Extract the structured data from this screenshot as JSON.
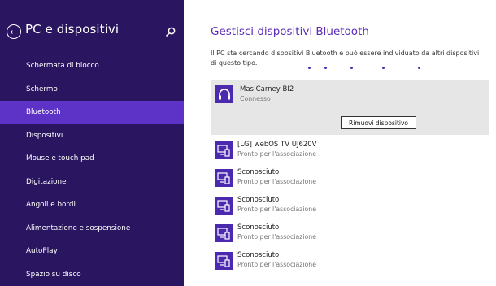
{
  "sidebar": {
    "title": "PC e dispositivi",
    "items": [
      {
        "label": "Schermata di blocco"
      },
      {
        "label": "Schermo"
      },
      {
        "label": "Bluetooth"
      },
      {
        "label": "Dispositivi"
      },
      {
        "label": "Mouse e touch pad"
      },
      {
        "label": "Digitazione"
      },
      {
        "label": "Angoli e bordi"
      },
      {
        "label": "Alimentazione e sospensione"
      },
      {
        "label": "AutoPlay"
      },
      {
        "label": "Spazio su disco"
      }
    ],
    "active_index": 2
  },
  "main": {
    "title": "Gestisci dispositivi Bluetooth",
    "description": "Il PC sta cercando dispositivi Bluetooth e può essere individuato da altri dispositivi di questo tipo.",
    "selected_device": {
      "name": "Mas Carney BI2",
      "status": "Connesso",
      "icon": "headphones-icon",
      "action_label": "Rimuovi dispositivo"
    },
    "devices": [
      {
        "name": "[LG] webOS TV UJ620V",
        "status": "Pronto per l'associazione",
        "icon": "device-icon"
      },
      {
        "name": "Sconosciuto",
        "status": "Pronto per l'associazione",
        "icon": "device-icon"
      },
      {
        "name": "Sconosciuto",
        "status": "Pronto per l'associazione",
        "icon": "device-icon"
      },
      {
        "name": "Sconosciuto",
        "status": "Pronto per l'associazione",
        "icon": "device-icon"
      },
      {
        "name": "Sconosciuto",
        "status": "Pronto per l'associazione",
        "icon": "device-icon"
      }
    ]
  },
  "colors": {
    "sidebar_bg": "#2a1560",
    "sidebar_active": "#5d33c7",
    "accent": "#5c2cb9",
    "icon_tile": "#4b2ab0"
  }
}
